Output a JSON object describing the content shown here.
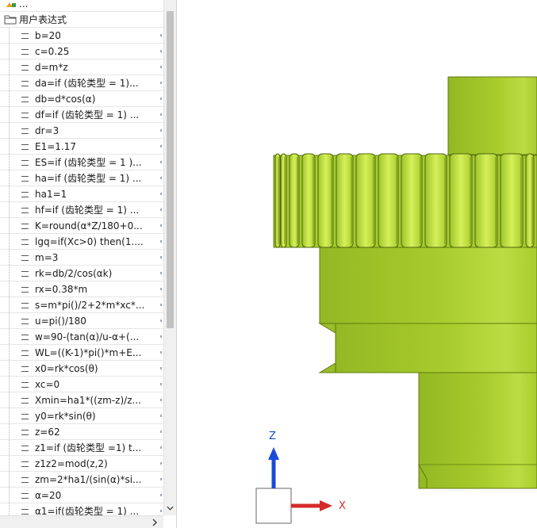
{
  "tree": {
    "partial_label": "...",
    "folder_label": "用户表达式",
    "expressions": [
      "b=20",
      "c=0.25",
      "d=m*z",
      "da=if (齿轮类型 = 1)...",
      "db=d*cos(α)",
      "df=if (齿轮类型 = 1) ...",
      "dr=3",
      "E1=1.17",
      "ES=if (齿轮类型 = 1 )...",
      "ha=if (齿轮类型 = 1) ...",
      "ha1=1",
      "hf=if (齿轮类型 = 1) ...",
      "K=round(α*Z/180+0...",
      "lgq=if(Xc>0) then(1....",
      "m=3",
      "rk=db/2/cos(αk)",
      "rx=0.38*m",
      "s=m*pi()/2+2*m*xc*...",
      "u=pi()/180",
      "w=90-(tan(α)/u-α+(...",
      "WL=((K-1)*pi()*m+E...",
      "x0=rk*cos(θ)",
      "xc=0",
      "Xmin=ha1*((zm-z)/z...",
      "y0=rk*sin(θ)",
      "z=62",
      "z1=if (齿轮类型 =1) t...",
      "z1z2=mod(z,2)",
      "zm=2*ha1/(sin(α)*si...",
      "α=20",
      "α1=if(齿轮类型 = 1) ...",
      "..."
    ]
  },
  "viewport": {
    "axis_z_label": "Z",
    "axis_x_label": "X",
    "colors": {
      "model_base": "#a8cc2c",
      "model_light": "#c8e84a",
      "model_dark": "#7e9e1a",
      "axis_z": "#1a4bd6",
      "axis_x": "#d62a2a"
    }
  }
}
